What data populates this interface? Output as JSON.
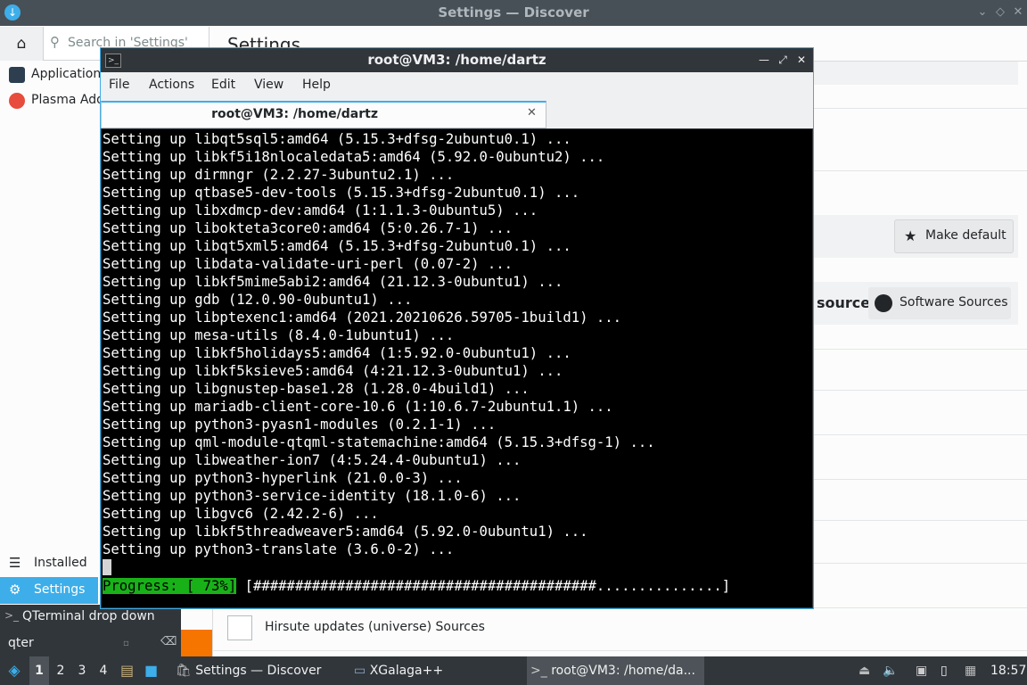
{
  "discover": {
    "title": "Settings — Discover",
    "search_placeholder": "Search in 'Settings'",
    "page_heading": "Settings",
    "sidebar_items": [
      {
        "label": "Applications"
      },
      {
        "label": "Plasma Addons"
      }
    ],
    "sidebar_bottom": {
      "installed": "Installed",
      "settings": "Settings"
    },
    "make_default": "Make default",
    "source_heading": "source",
    "software_sources": "Software Sources",
    "hirsute_label": "Hirsute updates (universe) Sources"
  },
  "launcher": {
    "item": "QTerminal drop down",
    "search_value": "qter"
  },
  "terminal": {
    "title": "root@VM3: /home/dartz",
    "menu": [
      "File",
      "Actions",
      "Edit",
      "View",
      "Help"
    ],
    "tab_title": "root@VM3: /home/dartz",
    "lines": [
      "Setting up libqt5sql5:amd64 (5.15.3+dfsg-2ubuntu0.1) ...",
      "Setting up libkf5i18nlocaledata5:amd64 (5.92.0-0ubuntu2) ...",
      "Setting up dirmngr (2.2.27-3ubuntu2.1) ...",
      "Setting up qtbase5-dev-tools (5.15.3+dfsg-2ubuntu0.1) ...",
      "Setting up libxdmcp-dev:amd64 (1:1.1.3-0ubuntu5) ...",
      "Setting up libokteta3core0:amd64 (5:0.26.7-1) ...",
      "Setting up libqt5xml5:amd64 (5.15.3+dfsg-2ubuntu0.1) ...",
      "Setting up libdata-validate-uri-perl (0.07-2) ...",
      "Setting up libkf5mime5abi2:amd64 (21.12.3-0ubuntu1) ...",
      "Setting up gdb (12.0.90-0ubuntu1) ...",
      "Setting up libptexenc1:amd64 (2021.20210626.59705-1build1) ...",
      "Setting up mesa-utils (8.4.0-1ubuntu1) ...",
      "Setting up libkf5holidays5:amd64 (1:5.92.0-0ubuntu1) ...",
      "Setting up libkf5ksieve5:amd64 (4:21.12.3-0ubuntu1) ...",
      "Setting up libgnustep-base1.28 (1.28.0-4build1) ...",
      "Setting up mariadb-client-core-10.6 (1:10.6.7-2ubuntu1.1) ...",
      "Setting up python3-pyasn1-modules (0.2.1-1) ...",
      "Setting up qml-module-qtqml-statemachine:amd64 (5.15.3+dfsg-1) ...",
      "Setting up libweather-ion7 (4:5.24.4-0ubuntu1) ...",
      "Setting up python3-hyperlink (21.0.0-3) ...",
      "Setting up python3-service-identity (18.1.0-6) ...",
      "Setting up libgvc6 (2.42.2-6) ...",
      "Setting up libkf5threadweaver5:amd64 (5.92.0-0ubuntu1) ...",
      "Setting up python3-translate (3.6.0-2) ..."
    ],
    "progress_label": "Progress: [ 73%]",
    "progress_bar": "[#########################################...............]"
  },
  "taskbar": {
    "workspaces": [
      "1",
      "2",
      "3",
      "4"
    ],
    "tasks": [
      {
        "label": "Settings — Discover"
      },
      {
        "label": "XGalaga++"
      },
      {
        "label": "root@VM3: /home/da..."
      }
    ],
    "clock": "18:57"
  },
  "colors": {
    "accent": "#3daee9",
    "progress_green": "#18b218",
    "dark_panel": "#31363b"
  }
}
